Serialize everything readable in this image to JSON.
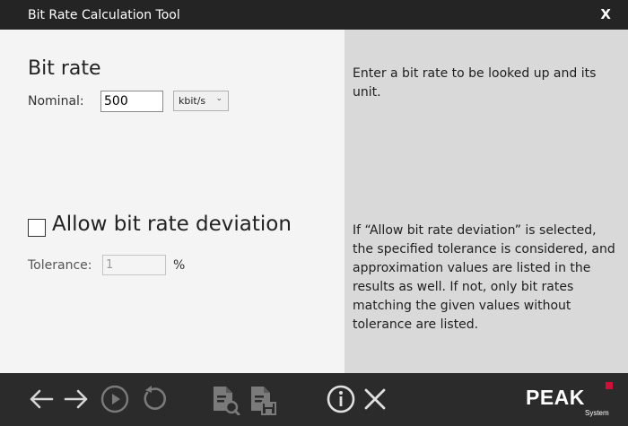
{
  "window": {
    "title": "Bit Rate Calculation Tool",
    "close_label": "X"
  },
  "bitrate": {
    "heading": "Bit rate",
    "nominal_label": "Nominal:",
    "nominal_value": "500",
    "unit_selected": "kbit/s"
  },
  "deviation": {
    "checkbox_label": "Allow bit rate deviation",
    "checked": false,
    "tolerance_label": "Tolerance:",
    "tolerance_value": "1",
    "percent_label": "%"
  },
  "help": {
    "bitrate_text": "Enter a bit rate to be looked up and its unit.",
    "deviation_text": "If “Allow bit rate deviation” is selected, the specified tolerance is considered, and approximation values are listed in the results as well. If not, only bit rates matching the given values without tolerance are listed."
  },
  "toolbar": {
    "icons": [
      "arrow-left-icon",
      "arrow-right-icon",
      "play-icon",
      "reset-icon",
      "document-search-icon",
      "document-save-icon",
      "info-icon",
      "close-icon"
    ]
  },
  "logo": {
    "word": "PEAK",
    "subtitle": "System",
    "accent": "#d0103a"
  },
  "colors": {
    "titlebar": "#242424",
    "help_panel": "#d9d9d9",
    "main_panel": "#f4f4f4",
    "toolbar": "#2b2b2b"
  }
}
